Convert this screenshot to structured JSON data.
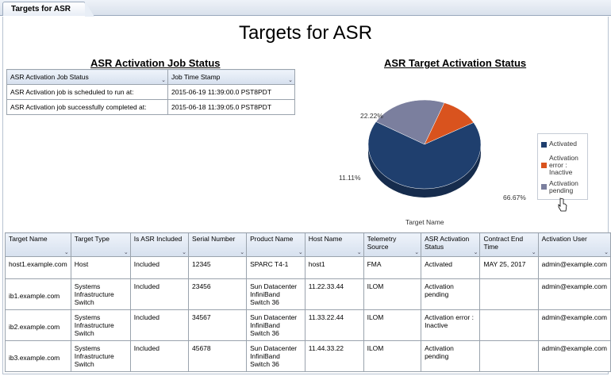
{
  "tab": {
    "label": "Targets for ASR"
  },
  "page": {
    "title": "Targets for ASR"
  },
  "job_status": {
    "section_title": "ASR Activation Job Status",
    "columns": [
      "ASR Activation Job Status",
      "Job Time Stamp"
    ],
    "rows": [
      [
        "ASR Activation job is scheduled to run at:",
        "2015-06-19 11:39:00.0 PST8PDT"
      ],
      [
        "ASR Activation job successfully completed at:",
        "2015-06-18 11:39:05.0 PST8PDT"
      ]
    ]
  },
  "chart_data": {
    "type": "pie",
    "title": "ASR Target Activation Status",
    "xlabel": "Target Name",
    "slices": [
      {
        "label": "Activated",
        "value": 66.67,
        "display": "66.67%",
        "color": "#1f3f6e"
      },
      {
        "label": "Activation error : Inactive",
        "value": 11.11,
        "display": "11.11%",
        "color": "#d9531e"
      },
      {
        "label": "Activation pending",
        "value": 22.22,
        "display": "22.22%",
        "color": "#7b7f9e"
      }
    ],
    "legend_position": "right"
  },
  "targets": {
    "columns": [
      "Target Name",
      "Target Type",
      "Is ASR Included",
      "Serial Number",
      "Product Name",
      "Host Name",
      "Telemetry Source",
      "ASR Activation Status",
      "Contract End Time",
      "Activation User"
    ],
    "rows": [
      [
        "host1.example.com",
        "Host",
        "Included",
        "12345",
        "SPARC T4-1",
        "host1",
        "FMA",
        "Activated",
        "MAY 25, 2017",
        "admin@example.com"
      ],
      [
        "ib1.example.com",
        "Systems Infrastructure Switch",
        "Included",
        "23456",
        "Sun Datacenter InfiniBand Switch 36",
        "11.22.33.44",
        "ILOM",
        "Activation pending",
        "",
        "admin@example.com"
      ],
      [
        "ib2.example.com",
        "Systems Infrastructure Switch",
        "Included",
        "34567",
        "Sun Datacenter InfiniBand Switch 36",
        "11.33.22.44",
        "ILOM",
        "Activation error : Inactive",
        "",
        "admin@example.com"
      ],
      [
        "ib3.example.com",
        "Systems Infrastructure Switch",
        "Included",
        "45678",
        "Sun Datacenter InfiniBand Switch 36",
        "11.44.33.22",
        "ILOM",
        "Activation pending",
        "",
        "admin@example.com"
      ]
    ]
  }
}
